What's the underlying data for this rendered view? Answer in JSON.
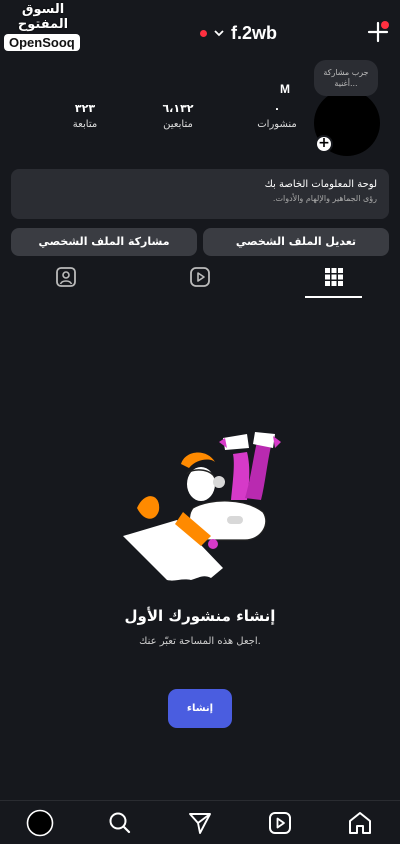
{
  "watermark": {
    "arabic": "السوق المفتوح",
    "english": "OpenSooq"
  },
  "header": {
    "username": "f.2wb",
    "has_notification": true
  },
  "note": {
    "text_line1": "جرب مشاركة",
    "text_line2": "أغنية..."
  },
  "profile": {
    "name": "M",
    "stats": [
      {
        "value": "٠",
        "label": "منشورات"
      },
      {
        "value": "٦،١٣٢",
        "label": "متابعين"
      },
      {
        "value": "٣٢٣",
        "label": "متابعة"
      }
    ]
  },
  "dashboard": {
    "title": "لوحة المعلومات الخاصة بك",
    "subtitle": "رؤى الجماهير والإلهام والأدوات."
  },
  "buttons": {
    "edit": "تعديل الملف الشخصي",
    "share": "مشاركة الملف الشخصي"
  },
  "tabs": [
    {
      "icon": "grid-icon",
      "active": true
    },
    {
      "icon": "reels-icon",
      "active": false
    },
    {
      "icon": "tagged-icon",
      "active": false
    }
  ],
  "empty_state": {
    "title": "إنشاء منشورك الأول",
    "subtitle": "اجعل هذه المساحة تعبّر عنك.",
    "button": "إنشاء"
  },
  "bottom_nav": [
    "profile-icon",
    "search-icon",
    "send-icon",
    "reels-icon",
    "home-icon"
  ],
  "colors": {
    "background": "#16181d",
    "card": "#2b2d33",
    "button": "#3a3c42",
    "accent": "#4a5de0",
    "notification": "#ff3040"
  }
}
